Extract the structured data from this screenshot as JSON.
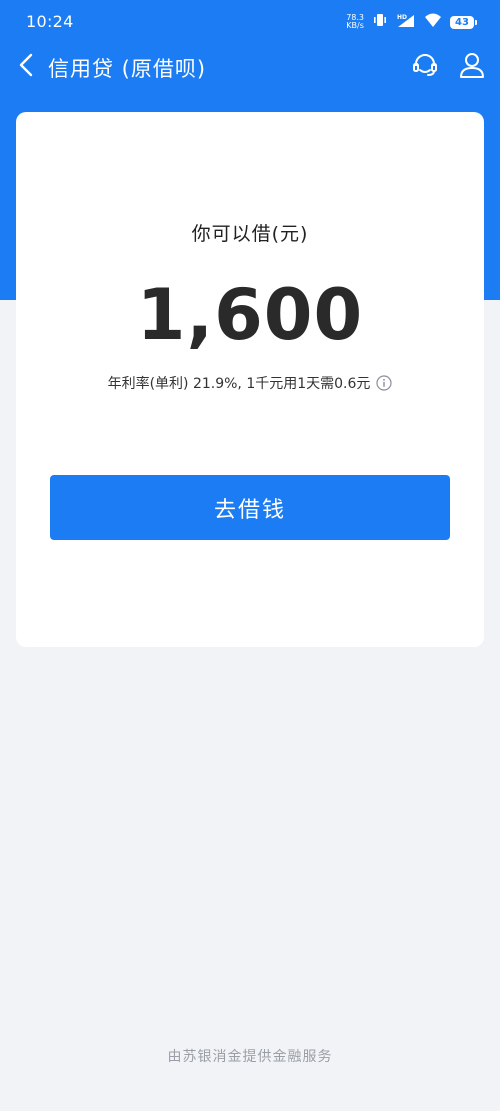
{
  "status_bar": {
    "time": "10:24",
    "net_speed_value": "78.3",
    "net_speed_unit": "KB/s",
    "battery": "43"
  },
  "nav": {
    "title": "信用贷 (原借呗)",
    "icons": [
      "back-arrow-icon",
      "headset-icon",
      "user-icon"
    ]
  },
  "card": {
    "limit_label": "你可以借(元)",
    "limit_amount": "1,600",
    "rate_text": "年利率(单利) 21.9%, 1千元用1天需0.6元",
    "borrow_button": "去借钱"
  },
  "footer": {
    "provider_text": "由苏银消金提供金融服务"
  },
  "colors": {
    "primary": "#1b7cf3",
    "background": "#f2f3f7",
    "card": "#ffffff",
    "footer_text": "#9a9ea6"
  }
}
